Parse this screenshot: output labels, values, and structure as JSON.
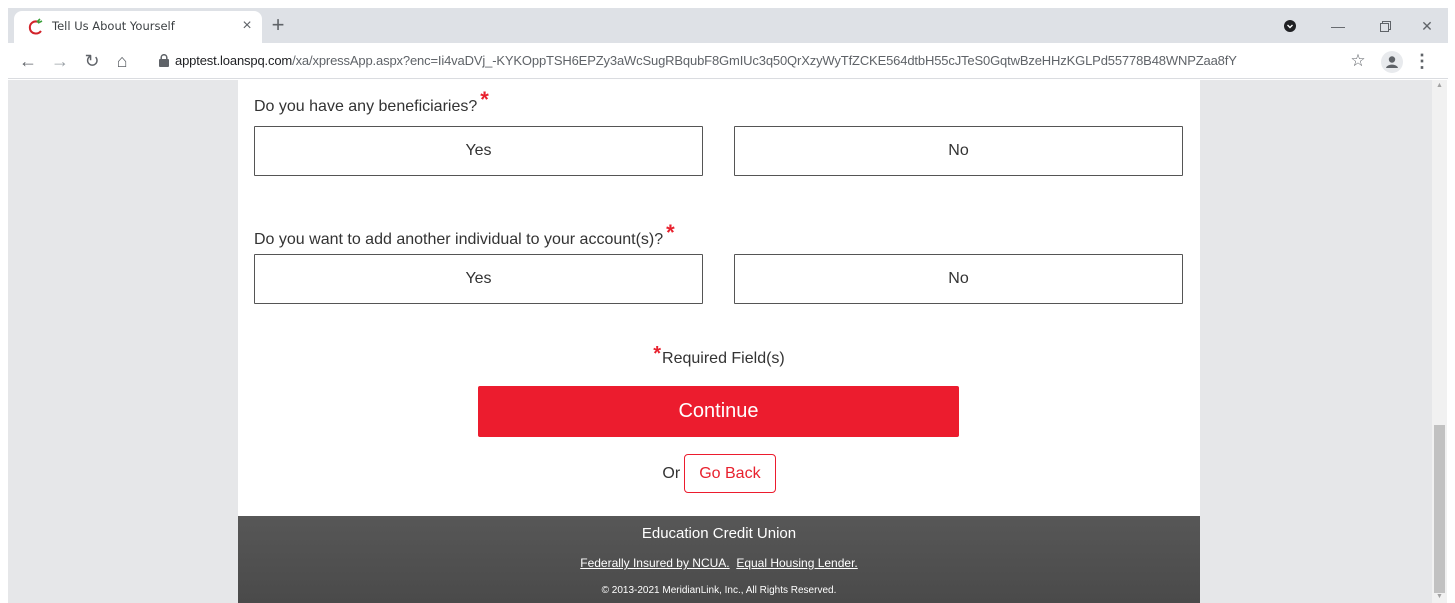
{
  "browser": {
    "tab_title": "Tell Us About Yourself",
    "tab_close": "×",
    "new_tab": "+",
    "url_host": "apptest.loanspq.com",
    "url_path": "/xa/xpressApp.aspx?enc=Ii4vaDVj_-KYKOppTSH6EPZy3aWcSugRBqubF8GmIUc3q50QrXzyWyTfZCKE564dtbH55cJTeS0GqtwBzeHHzKGLPd55778B48WNPZaa8fY",
    "icons": [
      "back-icon",
      "forward-icon",
      "reload-icon",
      "home-icon",
      "lock-icon",
      "star-icon",
      "profile-icon",
      "menu-icon",
      "minimize-icon",
      "maximize-icon",
      "close-icon"
    ]
  },
  "form": {
    "q1": {
      "label": "Do you have any beneficiaries?",
      "required_mark": "*",
      "yes": "Yes",
      "no": "No"
    },
    "q2": {
      "label": "Do you want to add another individual to your account(s)?",
      "required_mark": "*",
      "yes": "Yes",
      "no": "No"
    },
    "required_note_mark": "*",
    "required_note": "Required Field(s)",
    "continue_label": "Continue",
    "or_label": "Or",
    "go_back_label": "Go Back"
  },
  "footer": {
    "org_name": "Education Credit Union",
    "link1": "Federally Insured by NCUA.",
    "link2": "Equal Housing Lender.",
    "copyright": "© 2013-2021 MeridianLink, Inc., All Rights Reserved."
  },
  "colors": {
    "accent": "#ec1c2e",
    "footer_bg": "#4f4f4f",
    "page_bg": "#e6e7e9"
  }
}
